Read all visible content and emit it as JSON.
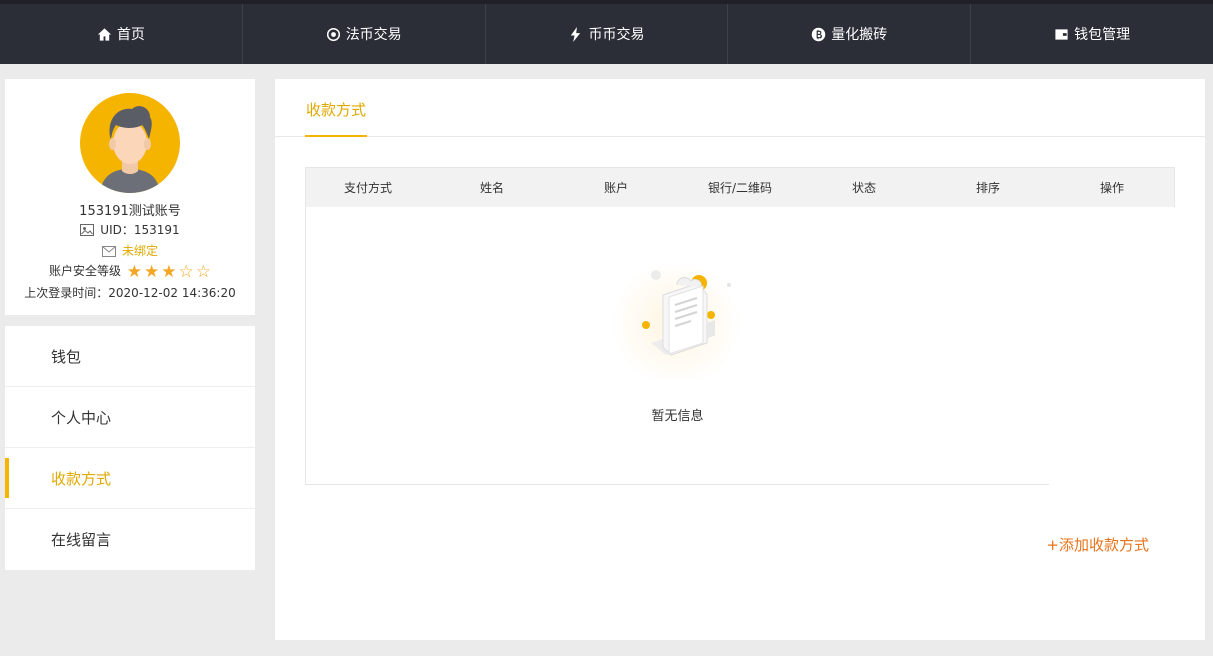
{
  "nav": {
    "items": [
      {
        "label": "首页",
        "icon": "home-icon"
      },
      {
        "label": "法币交易",
        "icon": "circle-target-icon"
      },
      {
        "label": "币币交易",
        "icon": "lightning-icon"
      },
      {
        "label": "量化搬砖",
        "icon": "bitcoin-icon"
      },
      {
        "label": "钱包管理",
        "icon": "wallet-icon"
      }
    ]
  },
  "profile": {
    "name": "153191测试账号",
    "uid_label": "UID：",
    "uid_value": "153191",
    "email_status": "未绑定",
    "security_label": "账户安全等级",
    "security_stars": 3,
    "security_max": 5,
    "last_login_label": "上次登录时间：",
    "last_login_value": "2020-12-02 14:36:20"
  },
  "menu": {
    "items": [
      {
        "label": "钱包"
      },
      {
        "label": "个人中心"
      },
      {
        "label": "收款方式"
      },
      {
        "label": "在线留言"
      }
    ],
    "active_index": 2
  },
  "main": {
    "tab_label": "收款方式",
    "columns": [
      "支付方式",
      "姓名",
      "账户",
      "银行/二维码",
      "状态",
      "排序",
      "操作"
    ],
    "empty_text": "暂无信息",
    "add_label": "+添加收款方式"
  },
  "colors": {
    "nav_bg": "#2b2d37",
    "accent": "#f5b400",
    "link_orange": "#e8741c",
    "page_bg": "#ebebeb"
  }
}
